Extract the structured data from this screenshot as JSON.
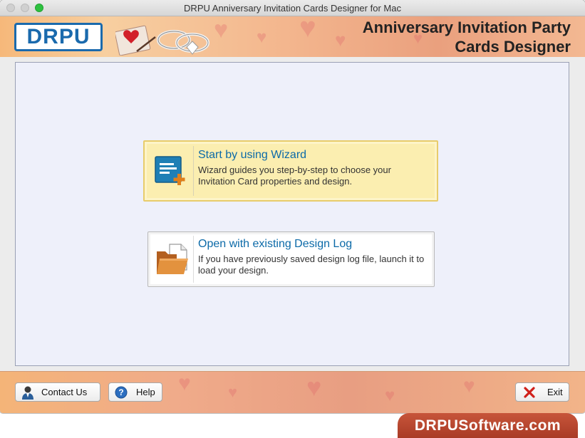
{
  "window": {
    "title": "DRPU Anniversary Invitation Cards Designer for Mac"
  },
  "banner": {
    "logo_text": "DRPU",
    "title_line1": "Anniversary Invitation Party",
    "title_line2": "Cards Designer",
    "art_icon": "rings-and-envelope-icon"
  },
  "options": [
    {
      "title": "Start by using Wizard",
      "desc_line1": "Wizard guides you step-by-step to choose your",
      "desc_line2": "Invitation Card properties and design.",
      "icon": "wizard-icon",
      "selected": true
    },
    {
      "title": "Open with existing Design Log",
      "desc_line1": "If you have previously saved design log file, launch it to",
      "desc_line2": "load your design.",
      "icon": "open-folder-icon",
      "selected": false
    }
  ],
  "footer": {
    "contact_label": "Contact Us",
    "help_label": "Help",
    "exit_label": "Exit",
    "contact_icon": "person-icon",
    "help_icon": "question-icon",
    "exit_icon": "red-x-icon"
  },
  "watermark": {
    "text": "DRPUSoftware.com"
  },
  "colors": {
    "accent_blue": "#0c6aa8",
    "selected_fill": "#fbeeb0",
    "exit_red": "#d0201a"
  }
}
